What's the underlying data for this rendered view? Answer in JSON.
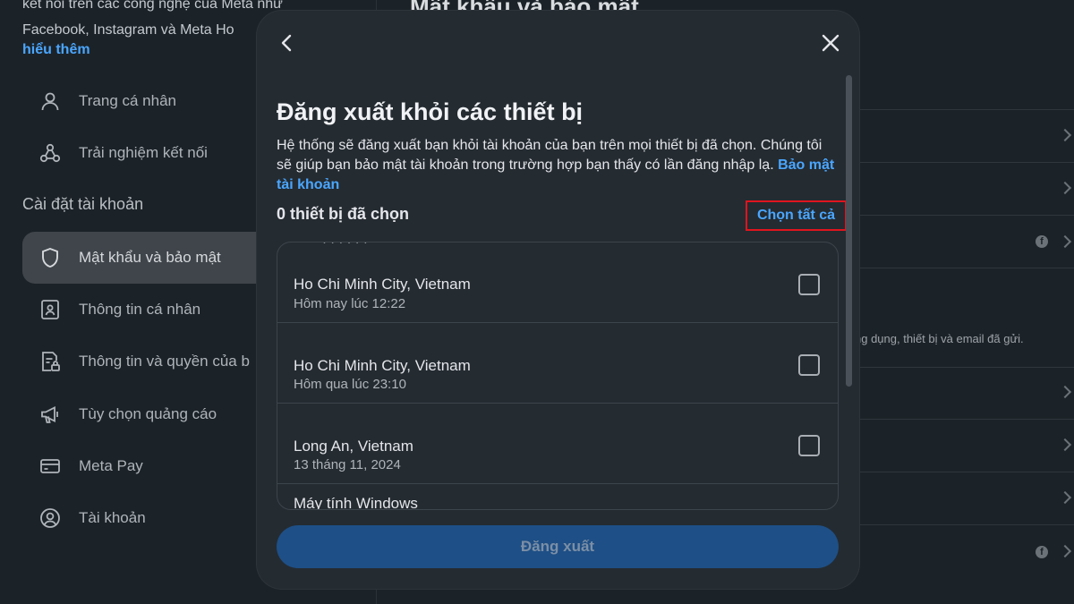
{
  "background": {
    "intro": {
      "line1": "kết nối trên các công nghệ của Meta như",
      "line2": "Facebook, Instagram và Meta Ho",
      "learn_more": "hiểu thêm"
    },
    "nav": [
      {
        "label": "Trang cá nhân",
        "icon": "person-icon"
      },
      {
        "label": "Trải nghiệm kết nối",
        "icon": "connected-icon"
      }
    ],
    "section_title": "Cài đặt tài khoản",
    "account_nav": [
      {
        "label": "Mật khẩu và bảo mật",
        "icon": "shield-icon",
        "active": true
      },
      {
        "label": "Thông tin cá nhân",
        "icon": "id-card-icon"
      },
      {
        "label": "Thông tin và quyền của b",
        "icon": "document-lock-icon"
      },
      {
        "label": "Tùy chọn quảng cáo",
        "icon": "megaphone-icon"
      },
      {
        "label": "Meta Pay",
        "icon": "card-icon"
      },
      {
        "label": "Tài khoản",
        "icon": "account-circle-icon"
      }
    ],
    "right_title": "Mật khẩu và bảo mật",
    "right_note": "ng dụng, thiết bị và email đã gửi."
  },
  "modal": {
    "title": "Đăng xuất khỏi các thiết bị",
    "description": "Hệ thống sẽ đăng xuất bạn khỏi tài khoản của bạn trên mọi thiết bị đã chọn. Chúng tôi sẽ giúp bạn bảo mật tài khoản trong trường hợp bạn thấy có lần đăng nhập lạ.",
    "security_link": "Bảo mật tài khoản",
    "selected_count": "0 thiết bị đã chọn",
    "select_all": "Chọn tất cả",
    "devices": [
      {
        "location": "Ho Chi Minh City, Vietnam",
        "time": "Hôm nay lúc 12:22",
        "checked": false
      },
      {
        "location": "Ho Chi Minh City, Vietnam",
        "time": "Hôm qua lúc 23:10",
        "checked": false
      },
      {
        "location": "Long An, Vietnam",
        "time": "13 tháng 11, 2024",
        "checked": false
      }
    ],
    "partial_device": "Máy tính Windows",
    "logout_button": "Đăng xuất"
  },
  "colors": {
    "accent_link": "#4aa6ff",
    "highlight_border": "#e0141e",
    "logout_bg": "#1e4f86"
  }
}
